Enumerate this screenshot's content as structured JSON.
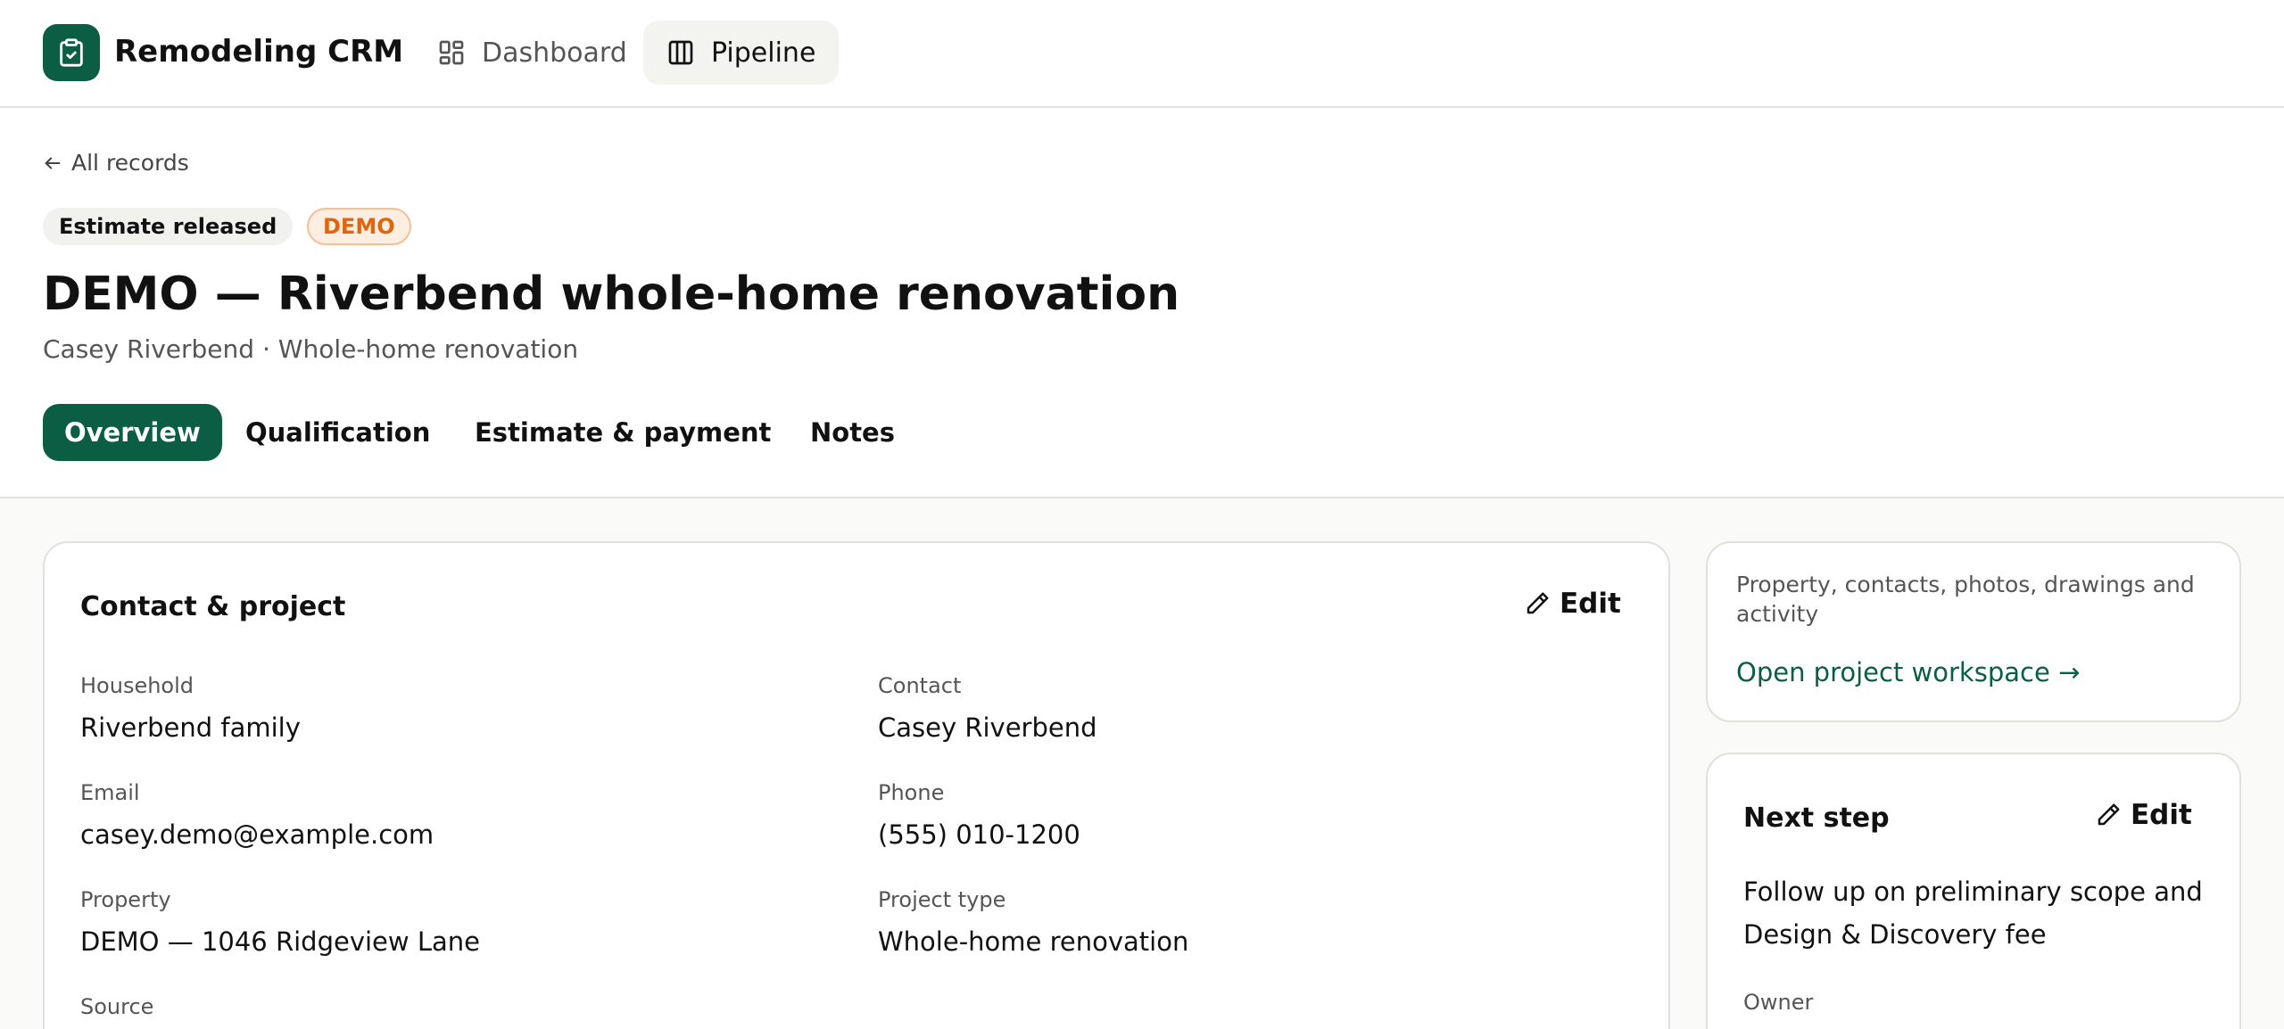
{
  "nav": {
    "brand": "Remodeling CRM",
    "brand_icon": "clipboard-check-icon",
    "items": [
      {
        "label": "Dashboard",
        "icon": "dashboard-grid-icon",
        "active": false
      },
      {
        "label": "Pipeline",
        "icon": "columns-icon",
        "active": true
      }
    ]
  },
  "header": {
    "back_label": "All records",
    "status_badge": "Estimate released",
    "demo_badge": "DEMO",
    "title": "DEMO — Riverbend whole-home renovation",
    "subtitle": "Casey Riverbend · Whole-home renovation"
  },
  "tabs": [
    {
      "label": "Overview",
      "active": true
    },
    {
      "label": "Qualification",
      "active": false
    },
    {
      "label": "Estimate & payment",
      "active": false
    },
    {
      "label": "Notes",
      "active": false
    }
  ],
  "contact_card": {
    "title": "Contact & project",
    "edit_label": "Edit",
    "fields": {
      "household": {
        "label": "Household",
        "value": "Riverbend family"
      },
      "contact": {
        "label": "Contact",
        "value": "Casey Riverbend"
      },
      "email": {
        "label": "Email",
        "value": "casey.demo@example.com"
      },
      "phone": {
        "label": "Phone",
        "value": "(555) 010-1200"
      },
      "property": {
        "label": "Property",
        "value": "DEMO — 1046 Ridgeview Lane"
      },
      "project_type": {
        "label": "Project type",
        "value": "Whole-home renovation"
      },
      "source": {
        "label": "Source"
      }
    }
  },
  "workspace_card": {
    "description": "Property, contacts, photos, drawings and activity",
    "link": "Open project workspace →"
  },
  "next_step_card": {
    "title": "Next step",
    "edit_label": "Edit",
    "text": "Follow up on preliminary scope and Design & Discovery fee",
    "owner_label": "Owner"
  },
  "colors": {
    "brand": "#0b5d44",
    "demo_badge_text": "#e0650e",
    "demo_badge_bg": "#fdeee2",
    "page_bg": "#fafaf8"
  }
}
